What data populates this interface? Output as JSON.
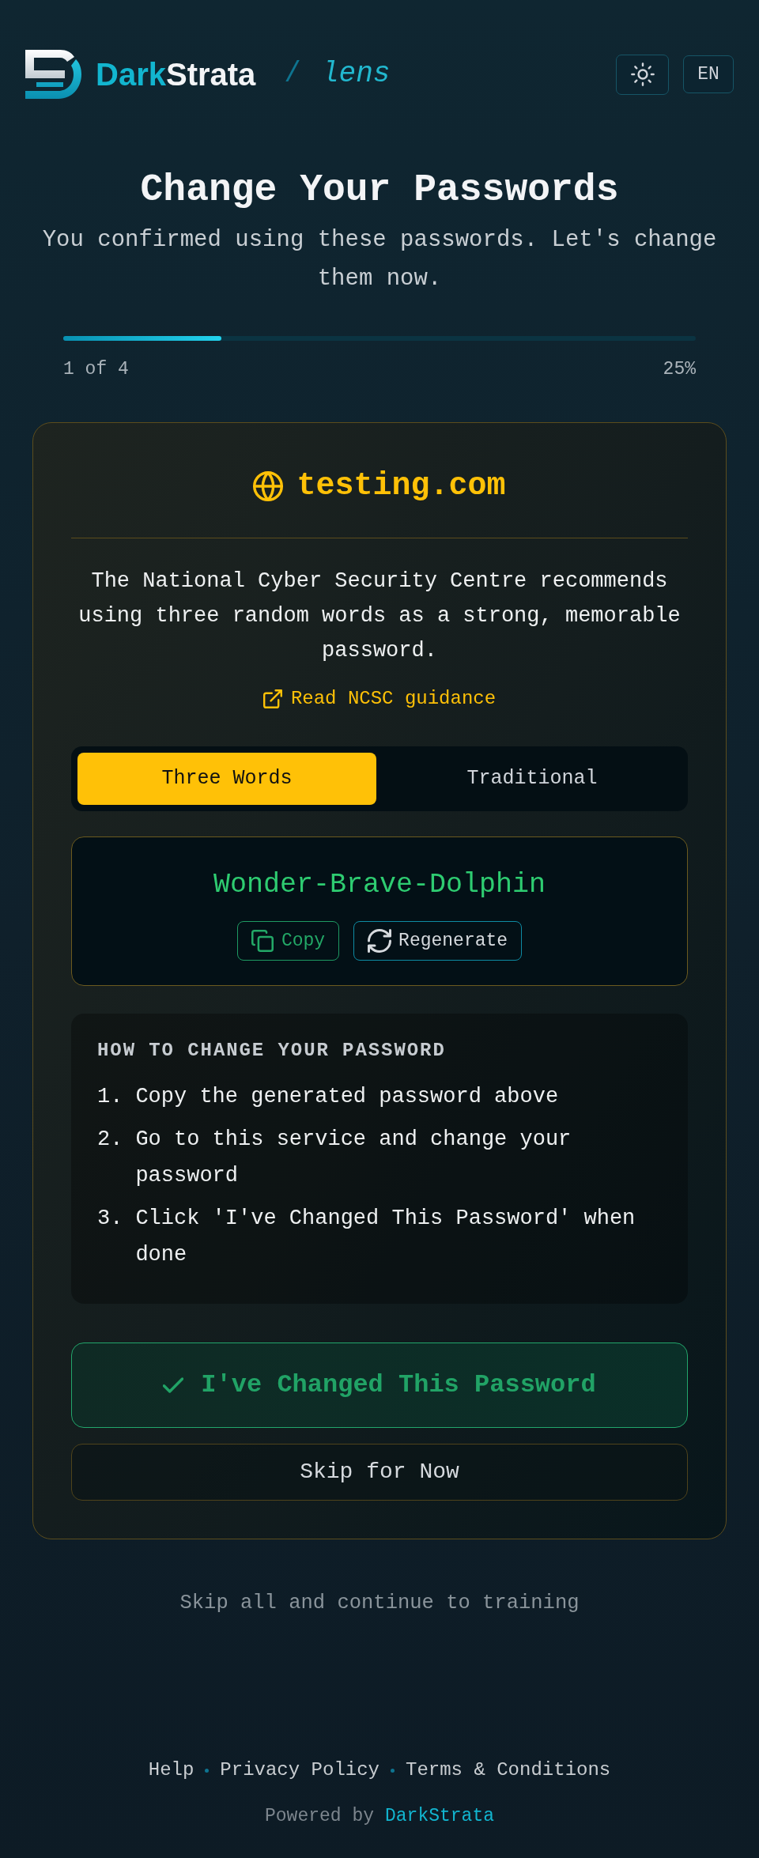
{
  "header": {
    "brand": [
      "Dark",
      "Strata"
    ],
    "separator": "/",
    "product": "lens",
    "language": "EN"
  },
  "intro": {
    "title": "Change Your Passwords",
    "subtitle": "You confirmed using these passwords. Let's change them now."
  },
  "progress": {
    "level": 0.25,
    "step": "1 of 4",
    "percent": "25%"
  },
  "card": {
    "site": "testing.com",
    "advice": "The National Cyber Security Centre recommends using three random words as a strong, memorable password.",
    "guidance_link": "Read NCSC guidance",
    "modes": [
      {
        "label": "Three Words",
        "selected": true
      },
      {
        "label": "Traditional",
        "selected": false
      }
    ],
    "password": "Wonder-Brave-Dolphin",
    "password_actions": [
      {
        "kind": "copy",
        "label": "Copy"
      },
      {
        "kind": "regenerate",
        "label": "Regenerate"
      }
    ],
    "instructions": {
      "heading": "HOW TO CHANGE YOUR PASSWORD",
      "steps": [
        {
          "number": "1.",
          "text": "Copy the generated password above"
        },
        {
          "number": "2.",
          "text": "Go to this service and change your password"
        },
        {
          "number": "3.",
          "text": "Click 'I've Changed This Password' when done"
        }
      ]
    },
    "confirm_button": "I've Changed This Password",
    "skip_button": "Skip for Now"
  },
  "skip_all_link": "Skip all and continue to training",
  "footer": {
    "links": [
      "Help",
      "Privacy Policy",
      "Terms & Conditions"
    ],
    "powered_by": "Powered by",
    "powered_brand": "DarkStrata"
  }
}
